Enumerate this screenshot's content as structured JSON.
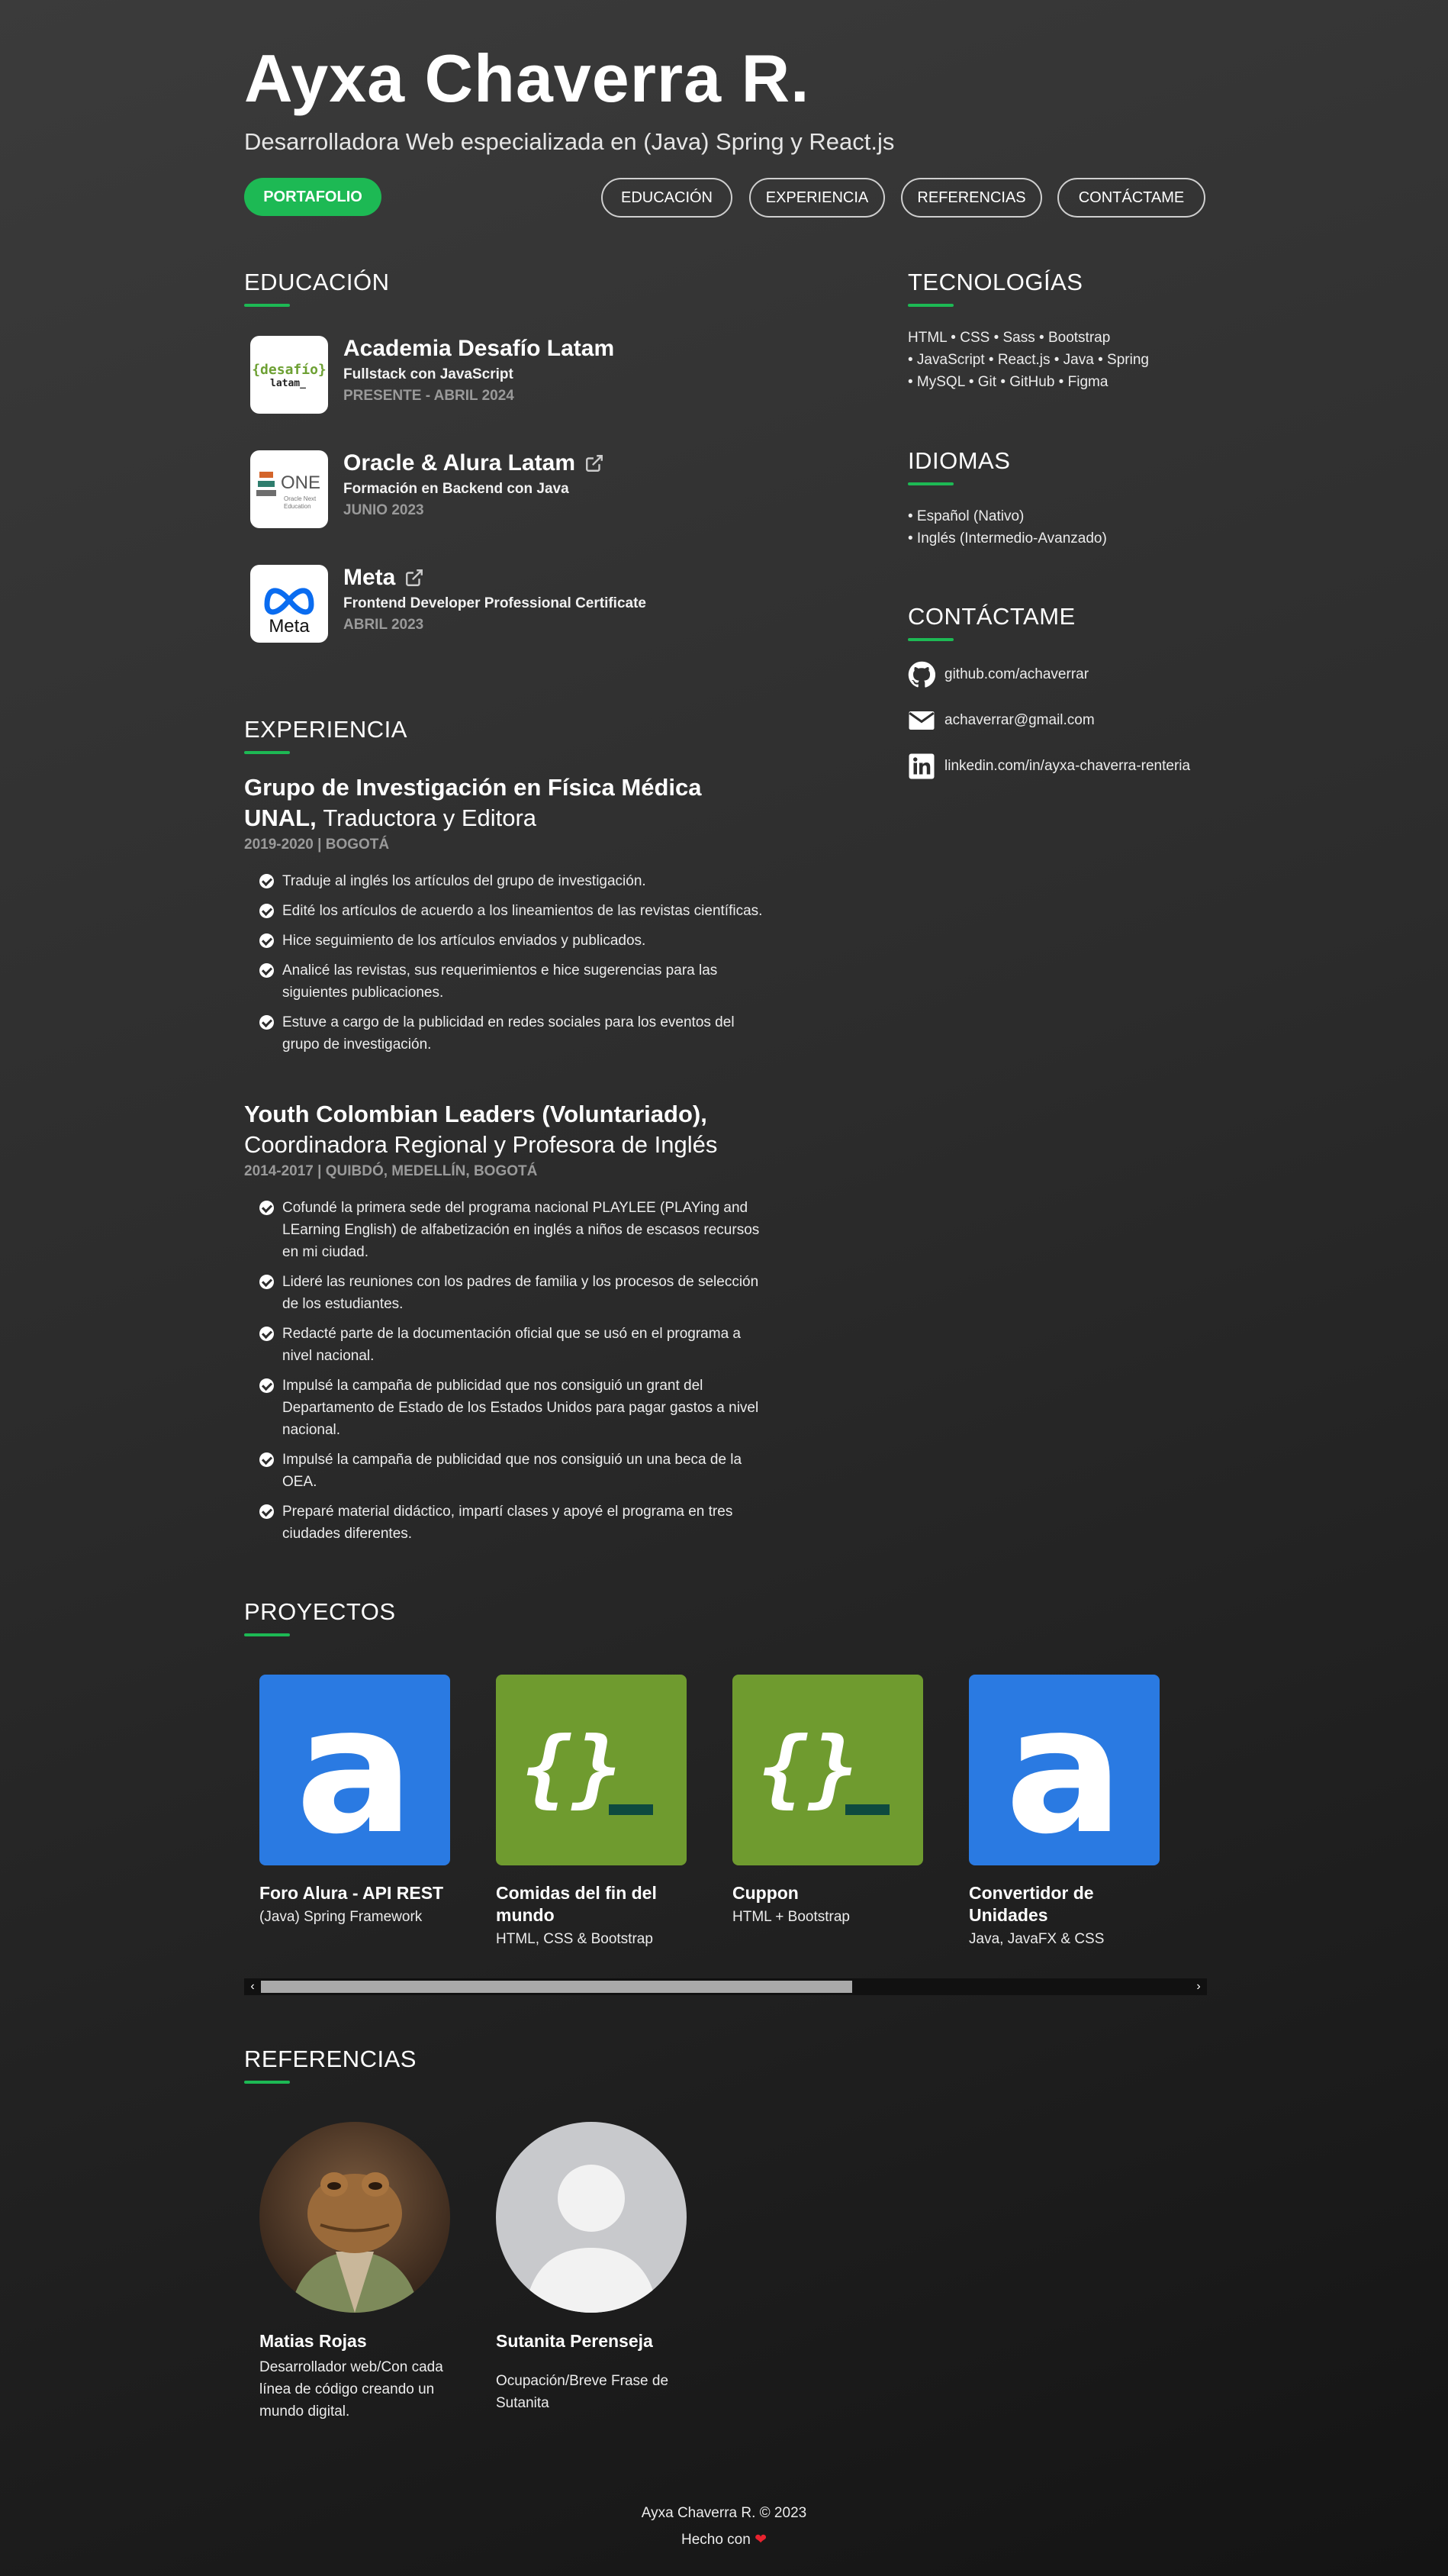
{
  "header": {
    "name": "Ayxa Chaverra R.",
    "subtitle": "Desarrolladora Web especializada en (Java) Spring y React.js"
  },
  "nav": {
    "primary": "PORTAFOLIO",
    "items": [
      "EDUCACIÓN",
      "EXPERIENCIA",
      "REFERENCIAS",
      "CONTÁCTAME"
    ]
  },
  "education": {
    "title": "EDUCACIÓN",
    "items": [
      {
        "logo": "desafio-latam-logo",
        "logo_text": "{desafío}",
        "logo_sub": "latam_",
        "title": "Academia Desafío Latam",
        "subtitle": "Fullstack con JavaScript",
        "date": "PRESENTE - ABRIL 2024"
      },
      {
        "logo": "oracle-one-logo",
        "logo_text": "ONE",
        "logo_sub": "Oracle Next Education",
        "title": "Oracle & Alura Latam",
        "subtitle": "Formación en Backend con Java",
        "date": "JUNIO 2023"
      },
      {
        "logo": "meta-logo",
        "logo_text": "Meta",
        "title": "Meta",
        "subtitle": "Frontend Developer Professional Certificate",
        "date": "ABRIL 2023"
      }
    ]
  },
  "experience": {
    "title": "EXPERIENCIA",
    "items": [
      {
        "org": "Grupo de Investigación en Física Médica UNAL,",
        "role": "Traductora y Editora",
        "date": "2019-2020 | BOGOTÁ",
        "bullets": [
          "Traduje al inglés los artículos del grupo de investigación.",
          "Edité los artículos de acuerdo a los lineamientos de las revistas científicas.",
          "Hice seguimiento de los artículos enviados y publicados.",
          "Analicé las revistas, sus requerimientos e hice sugerencias para las siguientes publicaciones.",
          "Estuve a cargo de la publicidad en redes sociales para los eventos del grupo de investigación."
        ]
      },
      {
        "org": "Youth Colombian Leaders (Voluntariado),",
        "role": "Coordinadora Regional y Profesora de Inglés",
        "date": "2014-2017 | QUIBDÓ, MEDELLÍN, BOGOTÁ",
        "bullets": [
          "Cofundé la primera sede del programa nacional PLAYLEE (PLAYing and LEarning English) de alfabetización en inglés a niños de escasos recursos en mi ciudad.",
          "Lideré las reuniones con los padres de familia y los procesos de selección de los estudiantes.",
          "Redacté parte de la documentación oficial que se usó en el programa a nivel nacional.",
          "Impulsé la campaña de publicidad que nos consiguió un grant del Departamento de Estado de los Estados Unidos para pagar gastos a nivel nacional.",
          "Impulsé la campaña de publicidad que nos consiguió un una beca de la OEA.",
          "Preparé material didáctico, impartí clases y apoyé el programa en tres ciudades diferentes."
        ]
      }
    ]
  },
  "technologies": {
    "title": "TECNOLOGÍAS",
    "lines": [
      "HTML  •  CSS  •  Sass  •  Bootstrap",
      "•  JavaScript  •  React.js  •  Java  •  Spring",
      "•  MySQL  •  Git  •  GitHub  •  Figma"
    ]
  },
  "languages": {
    "title": "IDIOMAS",
    "items": [
      "•  Español (Nativo)",
      "•  Inglés (Intermedio-Avanzado)"
    ]
  },
  "contact": {
    "title": "CONTÁCTAME",
    "items": [
      {
        "icon": "github-icon",
        "text": "github.com/achaverrar"
      },
      {
        "icon": "mail-icon",
        "text": "achaverrar@gmail.com"
      },
      {
        "icon": "linkedin-icon",
        "text": "linkedin.com/in/ayxa-chaverra-renteria"
      }
    ]
  },
  "projects": {
    "title": "PROYECTOS",
    "items": [
      {
        "thumb": "alura-logo",
        "color": "#2a7ae2",
        "title": "Foro Alura - API REST",
        "tech": "(Java) Spring Framework"
      },
      {
        "thumb": "code-logo",
        "color": "#6f9b2f",
        "title": "Comidas del fin del mundo",
        "tech": "HTML, CSS & Bootstrap"
      },
      {
        "thumb": "code-logo",
        "color": "#6f9b2f",
        "title": "Cuppon",
        "tech": "HTML + Bootstrap"
      },
      {
        "thumb": "alura-logo",
        "color": "#2a7ae2",
        "title": "Convertidor de Unidades",
        "tech": "Java, JavaFX & CSS"
      }
    ],
    "thumb_letter": "a",
    "thumb_code": "{}"
  },
  "references": {
    "title": "REFERENCIAS",
    "items": [
      {
        "avatar": "frog-avatar",
        "name": "Matias Rojas",
        "desc": "Desarrollador web/Con cada línea de código creando un mundo digital."
      },
      {
        "avatar": "default-avatar",
        "name": "Sutanita Perenseja",
        "desc": "Ocupación/Breve Frase de Sutanita"
      }
    ]
  },
  "footer": {
    "copyright": "Ayxa Chaverra R. © 2023",
    "made_with": "Hecho con",
    "heart": "❤"
  },
  "colors": {
    "accent": "#1db954",
    "alura_blue": "#2a7ae2",
    "code_green": "#6f9b2f"
  }
}
